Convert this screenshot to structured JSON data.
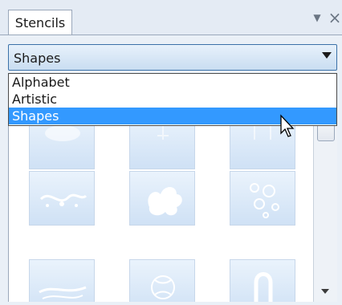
{
  "window": {
    "tab_label": "Stencils",
    "pin_icon": "triangle-down-icon",
    "close_icon": "close-icon"
  },
  "dropdown": {
    "selected_value": "Shapes",
    "options": [
      "Alphabet",
      "Artistic",
      "Shapes"
    ],
    "highlighted_option": "Shapes"
  },
  "stencils": {
    "tiles": [
      {
        "name": "stencil-tile-1"
      },
      {
        "name": "stencil-tile-2"
      },
      {
        "name": "stencil-tile-3"
      },
      {
        "name": "stencil-tile-4"
      },
      {
        "name": "stencil-tile-5"
      },
      {
        "name": "stencil-tile-6"
      },
      {
        "name": "stencil-tile-7"
      },
      {
        "name": "stencil-tile-8"
      },
      {
        "name": "stencil-tile-9"
      }
    ]
  },
  "colors": {
    "selection": "#3399ff",
    "dropdown_border": "#3b71a8"
  }
}
